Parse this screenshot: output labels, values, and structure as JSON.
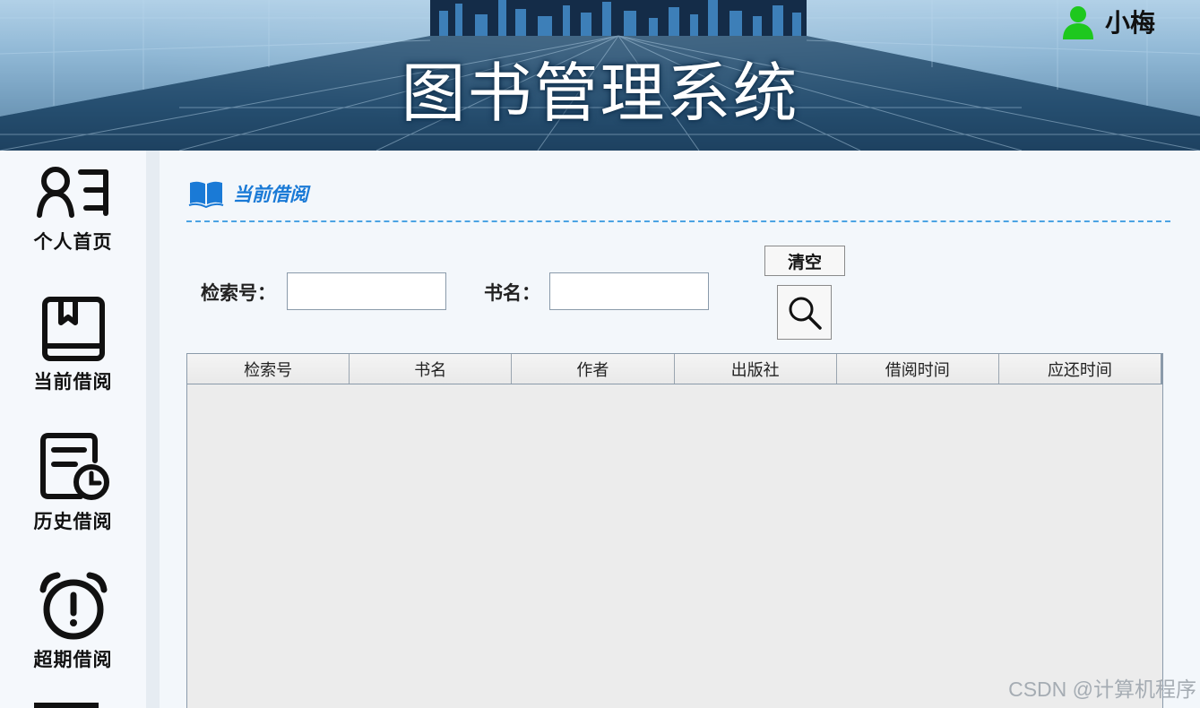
{
  "header": {
    "title": "图书管理系统",
    "user_name": "小梅"
  },
  "sidebar": {
    "items": [
      {
        "label": "个人首页",
        "icon": "profile-list-icon"
      },
      {
        "label": "当前借阅",
        "icon": "book-icon"
      },
      {
        "label": "历史借阅",
        "icon": "document-clock-icon"
      },
      {
        "label": "超期借阅",
        "icon": "alarm-clock-icon"
      }
    ]
  },
  "section": {
    "title": "当前借阅",
    "icon": "open-book-icon"
  },
  "search": {
    "index_label": "检索号：",
    "index_value": "",
    "name_label": "书名：",
    "name_value": "",
    "clear_label": "清空",
    "search_icon": "magnifier-icon"
  },
  "table": {
    "columns": [
      "检索号",
      "书名",
      "作者",
      "出版社",
      "借阅时间",
      "应还时间"
    ],
    "rows": []
  },
  "watermark": "CSDN @计算机程序",
  "colors": {
    "accent": "#1a7ad6",
    "user_icon": "#1ec81e",
    "divider": "#4ba3e3"
  }
}
